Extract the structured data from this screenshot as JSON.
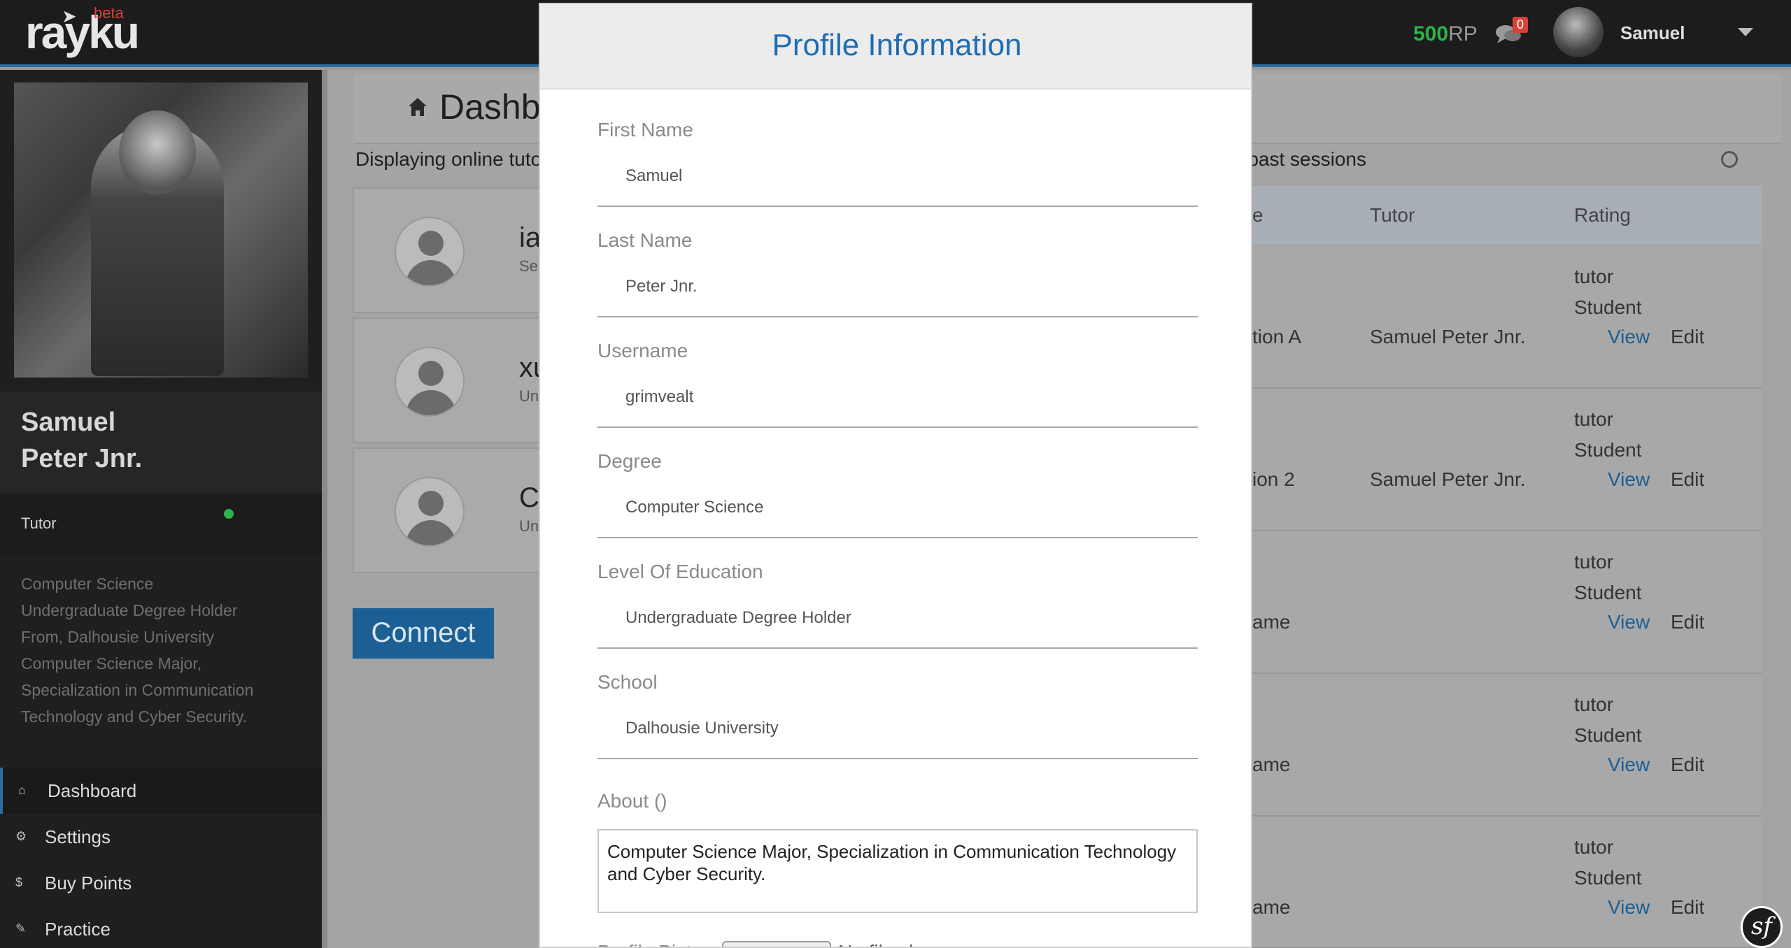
{
  "topbar": {
    "logo": "rayku",
    "logo_badge": "beta",
    "points_value": "500",
    "points_unit": "RP",
    "message_count": "0",
    "user_name": "Samuel"
  },
  "sidebar": {
    "first_name": "Samuel",
    "last_name": "Peter Jnr.",
    "role": "Tutor",
    "bio": [
      "Computer Science",
      "Undergraduate Degree Holder",
      "From, Dalhousie University",
      "Computer Science Major,",
      "Specialization in Communication",
      "Technology and Cyber Security."
    ],
    "nav": [
      {
        "label": "Dashboard",
        "icon": "home-icon"
      },
      {
        "label": "Settings",
        "icon": "gear-icon"
      },
      {
        "label": "Buy Points",
        "icon": "coin-icon"
      },
      {
        "label": "Practice",
        "icon": "pencil-icon"
      }
    ]
  },
  "main": {
    "title": "Dashbo",
    "displaying_left": "Displaying online tuto",
    "displaying_right": "g past sessions",
    "tutors": [
      {
        "name": "ia",
        "sub": "Se"
      },
      {
        "name": "xu",
        "sub": "Un"
      },
      {
        "name": "C",
        "sub": "Un"
      }
    ],
    "connect_label": "Connect",
    "table": {
      "headers": [
        "e",
        "Tutor",
        "Rating"
      ],
      "rows": [
        {
          "col1": "tion A",
          "tutor": "Samuel Peter Jnr.",
          "rating1": "tutor",
          "rating2": "Student",
          "view": "View",
          "edit": "Edit"
        },
        {
          "col1": "ion 2",
          "tutor": "Samuel Peter Jnr.",
          "rating1": "tutor",
          "rating2": "Student",
          "view": "View",
          "edit": "Edit"
        },
        {
          "col1": "ame",
          "tutor": "",
          "rating1": "tutor",
          "rating2": "Student",
          "view": "View",
          "edit": "Edit"
        },
        {
          "col1": "ame",
          "tutor": "",
          "rating1": "tutor",
          "rating2": "Student",
          "view": "View",
          "edit": "Edit"
        },
        {
          "col1": "ame",
          "tutor": "",
          "rating1": "tutor",
          "rating2": "Student",
          "view": "View",
          "edit": "Edit"
        }
      ]
    }
  },
  "modal": {
    "title": "Profile Information",
    "fields": [
      {
        "label": "First Name",
        "value": "Samuel"
      },
      {
        "label": "Last Name",
        "value": "Peter Jnr."
      },
      {
        "label": "Username",
        "value": "grimvealt"
      },
      {
        "label": "Degree",
        "value": "Computer Science"
      },
      {
        "label": "Level Of Education",
        "value": "Undergraduate Degree Holder"
      },
      {
        "label": "School",
        "value": "Dalhousie University"
      }
    ],
    "about_label": "About ()",
    "about_value": "Computer Science Major, Specialization in Communication Technology and Cyber Security.",
    "picture_label": "Profile Pictur",
    "file_status": "No file chosen"
  },
  "colors": {
    "accent": "#1f6db5",
    "points_green": "#2db34a",
    "badge_red": "#d9403a"
  }
}
